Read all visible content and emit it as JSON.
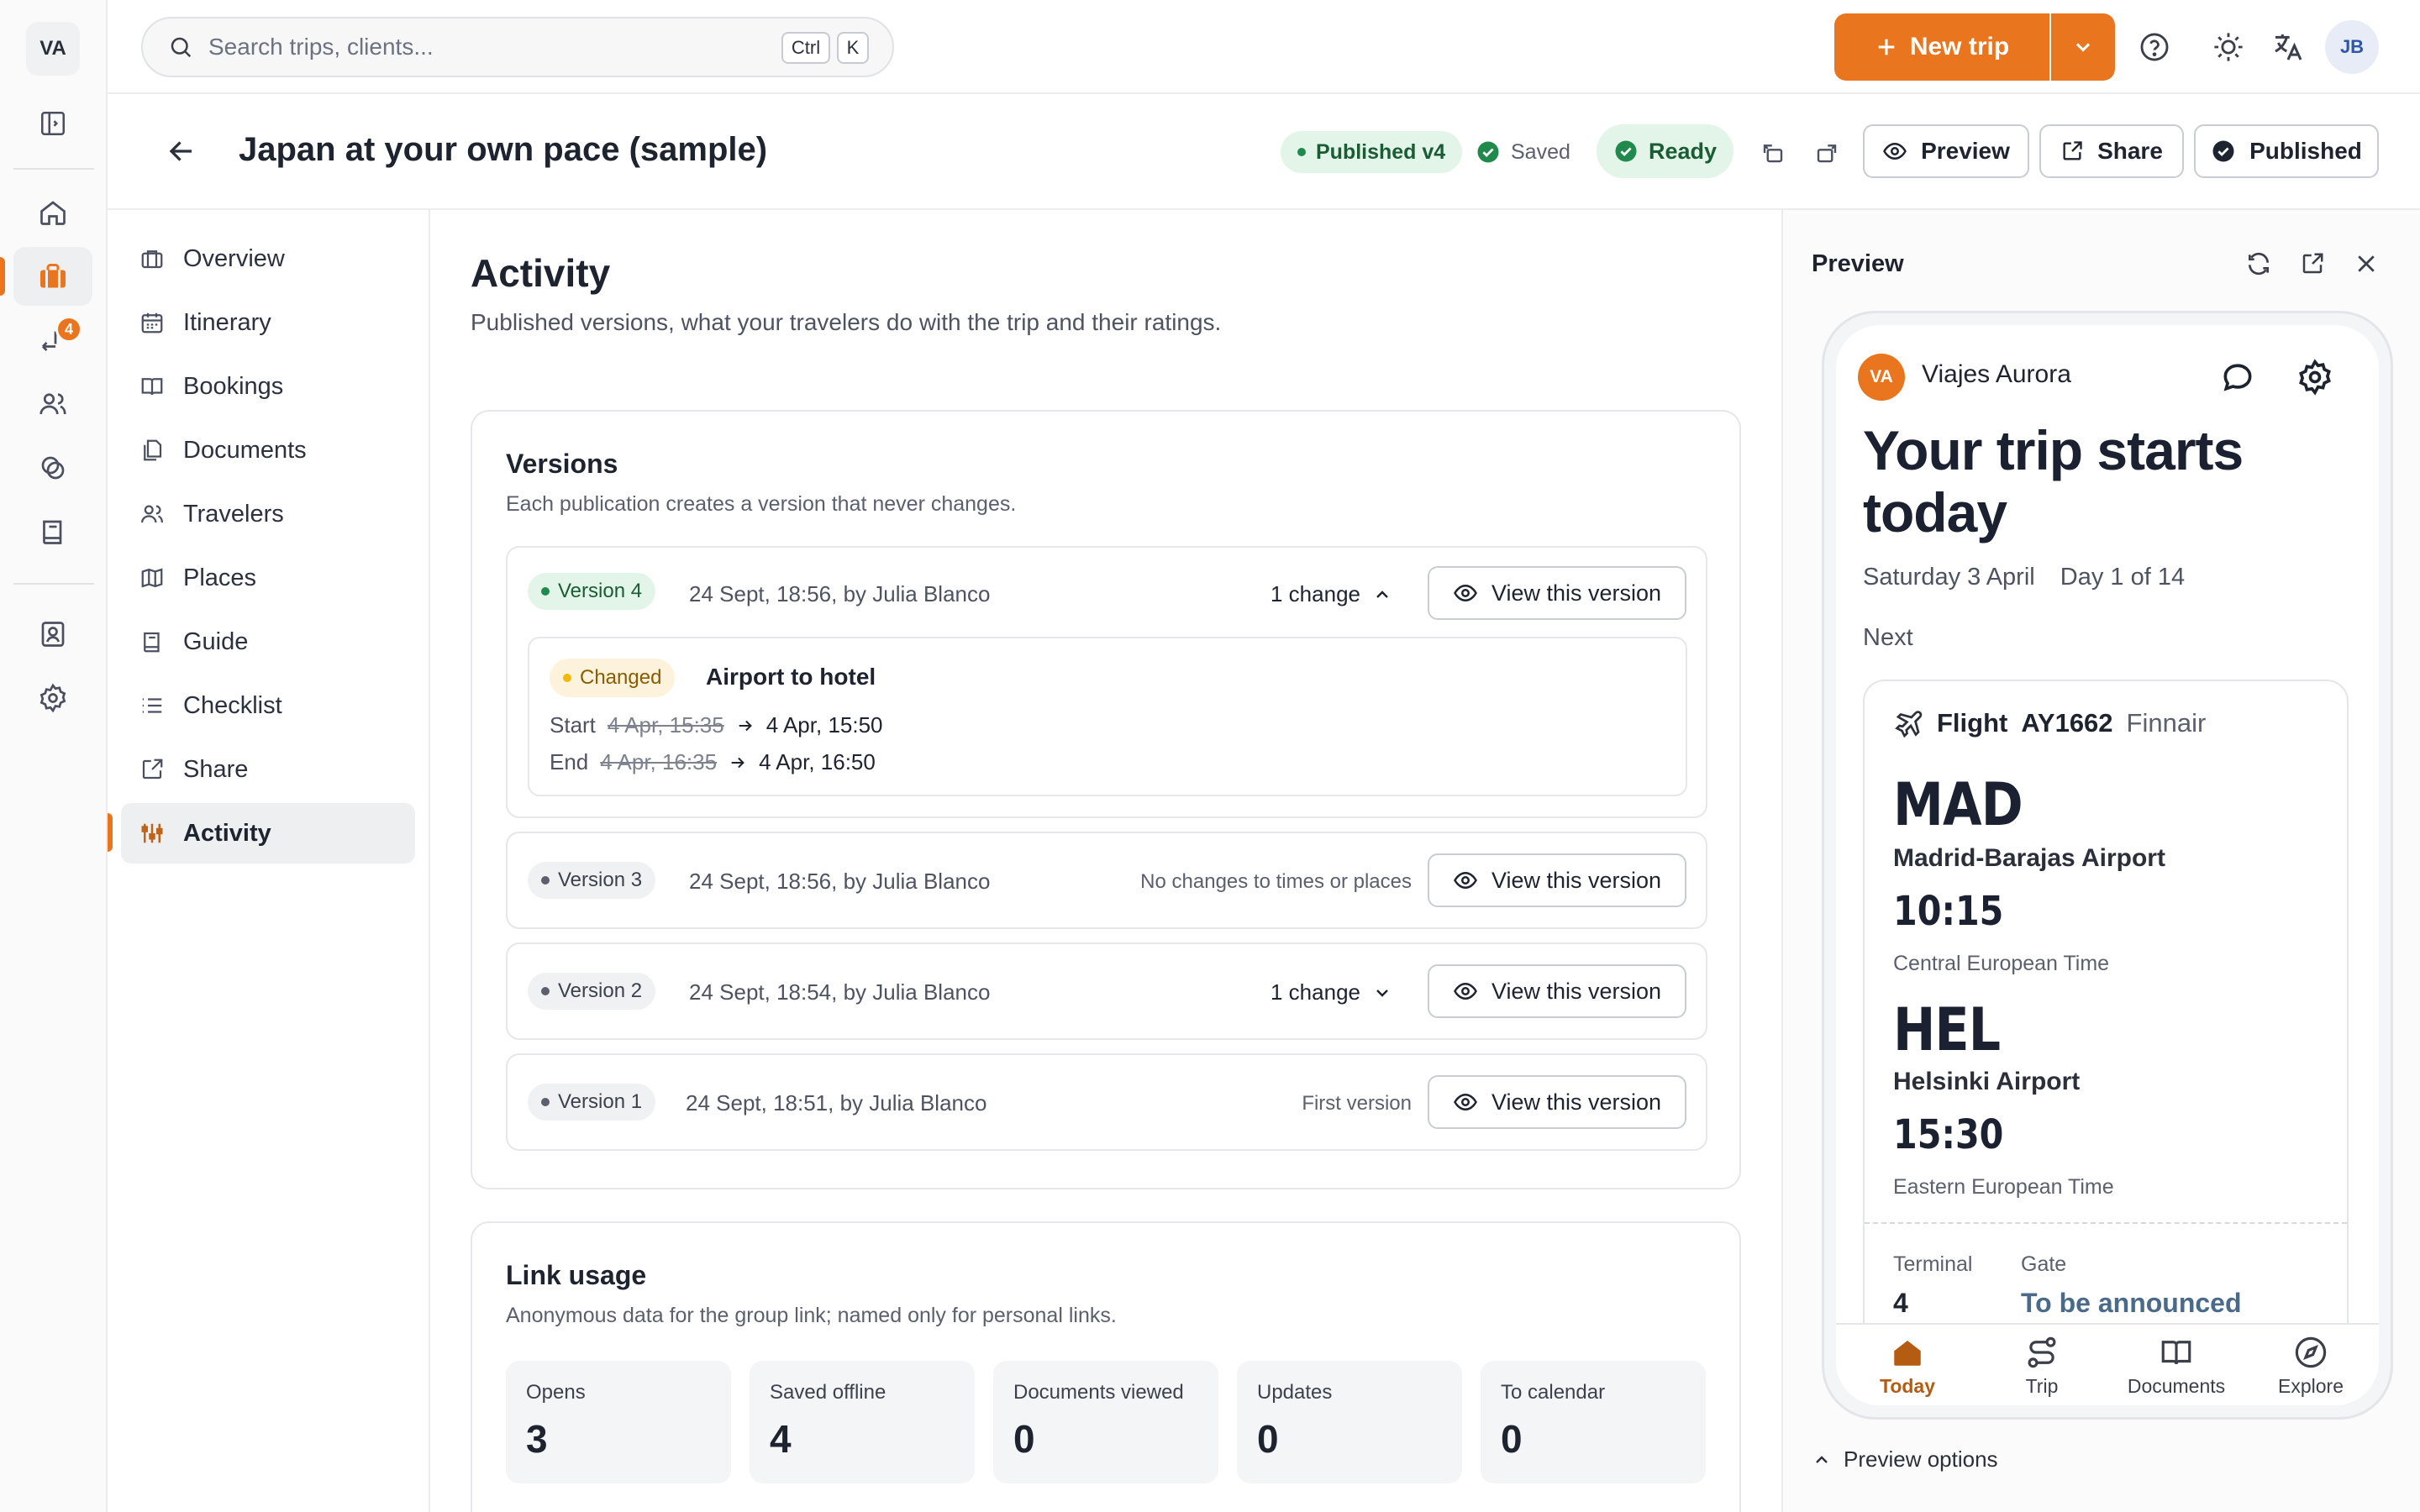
{
  "rail": {
    "logo": "VA",
    "badge_count": "4"
  },
  "topbar": {
    "search_placeholder": "Search trips, clients...",
    "shortcut_key1": "Ctrl",
    "shortcut_key2": "K",
    "new_trip_label": "New trip",
    "user_initials": "JB"
  },
  "header": {
    "title": "Japan at your own pace (sample)",
    "published_status": "Published v4",
    "saved_status": "Saved",
    "ready_status": "Ready",
    "preview_label": "Preview",
    "share_label": "Share",
    "published_label": "Published"
  },
  "nav": {
    "items": [
      {
        "label": "Overview"
      },
      {
        "label": "Itinerary"
      },
      {
        "label": "Bookings"
      },
      {
        "label": "Documents"
      },
      {
        "label": "Travelers"
      },
      {
        "label": "Places"
      },
      {
        "label": "Guide"
      },
      {
        "label": "Checklist"
      },
      {
        "label": "Share"
      },
      {
        "label": "Activity"
      }
    ],
    "active": "Activity"
  },
  "main": {
    "title": "Activity",
    "subtitle": "Published versions, what your travelers do with the trip and their ratings.",
    "versions": {
      "title": "Versions",
      "subtitle": "Each publication creates a version that never changes.",
      "view_label": "View this version",
      "items": [
        {
          "badge": "Version 4",
          "meta": "24 Sept, 18:56, by Julia Blanco",
          "change_summary": "1 change",
          "expanded": true,
          "change": {
            "status": "Changed",
            "name": "Airport to hotel",
            "start_label": "Start",
            "start_old": "4 Apr, 15:35",
            "start_new": "4 Apr, 15:50",
            "end_label": "End",
            "end_old": "4 Apr, 16:35",
            "end_new": "4 Apr, 16:50"
          }
        },
        {
          "badge": "Version 3",
          "meta": "24 Sept, 18:56, by Julia Blanco",
          "note": "No changes to times or places"
        },
        {
          "badge": "Version 2",
          "meta": "24 Sept, 18:54, by Julia Blanco",
          "change_summary": "1 change"
        },
        {
          "badge": "Version 1",
          "meta": "24 Sept, 18:51, by Julia Blanco",
          "note": "First version"
        }
      ]
    },
    "link_usage": {
      "title": "Link usage",
      "subtitle": "Anonymous data for the group link; named only for personal links.",
      "stats": [
        {
          "label": "Opens",
          "value": "3"
        },
        {
          "label": "Saved offline",
          "value": "4"
        },
        {
          "label": "Documents viewed",
          "value": "0"
        },
        {
          "label": "Updates",
          "value": "0"
        },
        {
          "label": "To calendar",
          "value": "0"
        }
      ]
    }
  },
  "preview": {
    "title": "Preview",
    "options_label": "Preview options",
    "phone": {
      "agency_initials": "VA",
      "agency_name": "Viajes Aurora",
      "headline": "Your trip starts today",
      "date": "Saturday 3 April",
      "day_counter": "Day 1 of 14",
      "next_label": "Next",
      "flight": {
        "type": "Flight",
        "number": "AY1662",
        "airline": "Finnair",
        "from_code": "MAD",
        "from_airport": "Madrid-Barajas Airport",
        "depart_time": "10:15",
        "from_tz": "Central European Time",
        "to_code": "HEL",
        "to_airport": "Helsinki Airport",
        "arrive_time": "15:30",
        "to_tz": "Eastern European Time",
        "terminal_label": "Terminal",
        "terminal_value": "4",
        "gate_label": "Gate",
        "gate_value": "To be announced"
      },
      "tabs": [
        {
          "label": "Today"
        },
        {
          "label": "Trip"
        },
        {
          "label": "Documents"
        },
        {
          "label": "Explore"
        }
      ]
    }
  },
  "colors": {
    "accent": "#e9751e",
    "success_green": "#1f8a4c",
    "success_bg": "#e3f4e8",
    "changed_bg": "#fdf3dc",
    "highlight": "#f5b800"
  },
  "icons": {
    "rail": [
      "sidebar-toggle-icon",
      "home-icon",
      "briefcase-icon",
      "transfer-icon",
      "users-icon",
      "copy-icon",
      "book-icon",
      "contact-card-icon",
      "settings-icon"
    ],
    "nav": [
      "briefcase-icon",
      "calendar-icon",
      "book-open-icon",
      "files-icon",
      "users-icon",
      "map-icon",
      "book-icon",
      "list-icon",
      "share-icon",
      "activity-icon"
    ]
  }
}
